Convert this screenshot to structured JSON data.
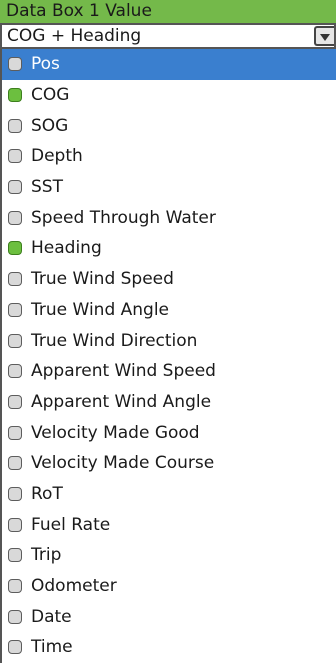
{
  "header": {
    "title": "Data Box 1 Value"
  },
  "select": {
    "value": "COG + Heading",
    "icon": "chevron-down-icon"
  },
  "colors": {
    "title_bar": "#74b94a",
    "selected_row": "#3a7fcf",
    "checked_box": "#6cbf3f",
    "unchecked_box": "#d9d9d9"
  },
  "options": [
    {
      "label": "Pos",
      "checked": false,
      "highlighted": true
    },
    {
      "label": "COG",
      "checked": true,
      "highlighted": false
    },
    {
      "label": "SOG",
      "checked": false,
      "highlighted": false
    },
    {
      "label": "Depth",
      "checked": false,
      "highlighted": false
    },
    {
      "label": "SST",
      "checked": false,
      "highlighted": false
    },
    {
      "label": "Speed Through Water",
      "checked": false,
      "highlighted": false
    },
    {
      "label": "Heading",
      "checked": true,
      "highlighted": false
    },
    {
      "label": "True Wind Speed",
      "checked": false,
      "highlighted": false
    },
    {
      "label": "True Wind Angle",
      "checked": false,
      "highlighted": false
    },
    {
      "label": "True Wind Direction",
      "checked": false,
      "highlighted": false
    },
    {
      "label": "Apparent Wind Speed",
      "checked": false,
      "highlighted": false
    },
    {
      "label": "Apparent Wind Angle",
      "checked": false,
      "highlighted": false
    },
    {
      "label": "Velocity Made Good",
      "checked": false,
      "highlighted": false
    },
    {
      "label": "Velocity Made Course",
      "checked": false,
      "highlighted": false
    },
    {
      "label": "RoT",
      "checked": false,
      "highlighted": false
    },
    {
      "label": "Fuel Rate",
      "checked": false,
      "highlighted": false
    },
    {
      "label": "Trip",
      "checked": false,
      "highlighted": false
    },
    {
      "label": "Odometer",
      "checked": false,
      "highlighted": false
    },
    {
      "label": "Date",
      "checked": false,
      "highlighted": false
    },
    {
      "label": "Time",
      "checked": false,
      "highlighted": false
    }
  ]
}
